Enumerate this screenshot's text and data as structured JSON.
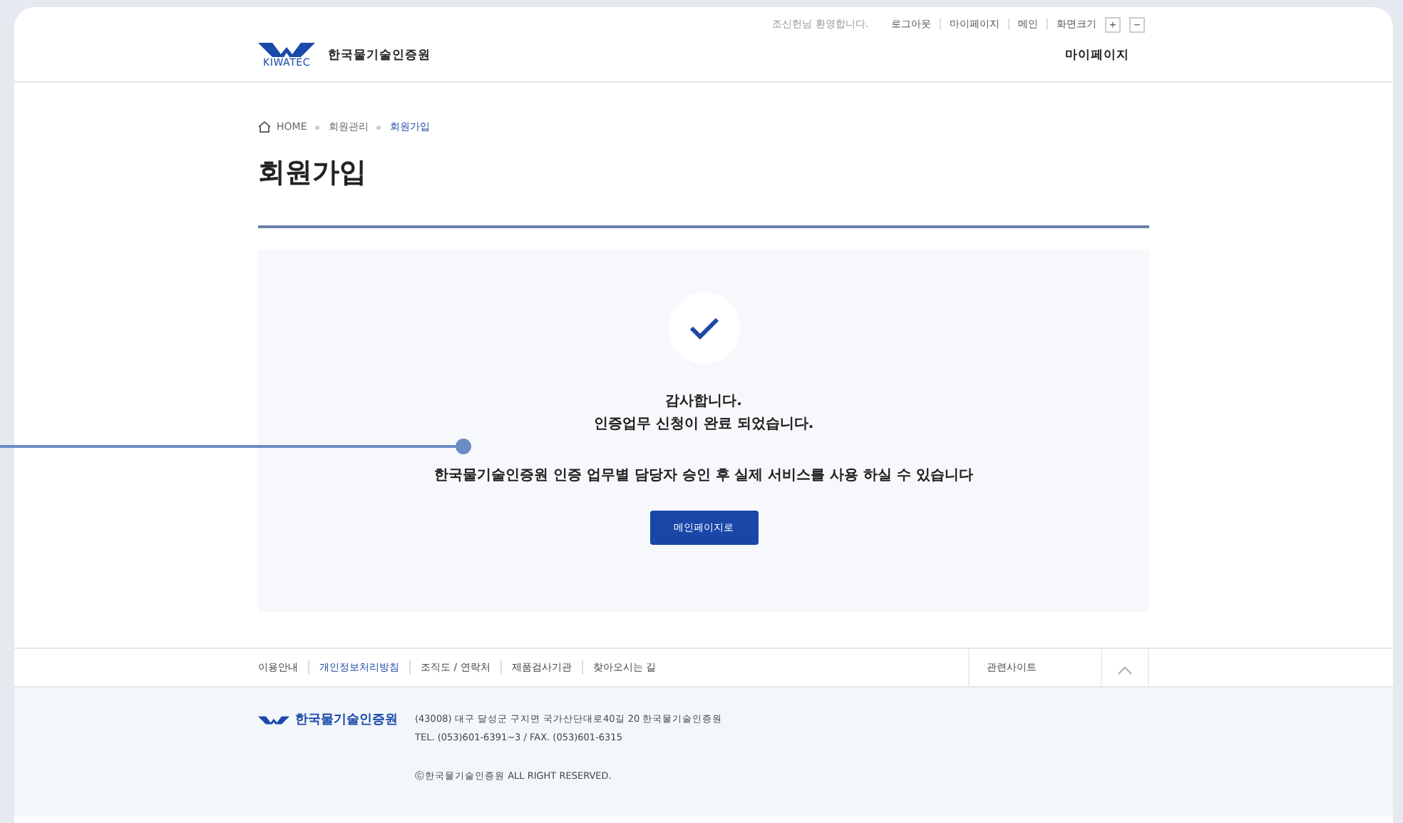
{
  "top_bar": {
    "greeting": "조신헌님 환영합니다.",
    "links": [
      "로그아웃",
      "마이페이지",
      "메인"
    ],
    "zoom_label": "화면크기",
    "zoom_in": "+",
    "zoom_out": "−"
  },
  "header": {
    "logo_text": "KIWATEC",
    "site_name": "한국물기술인증원",
    "nav": "마이페이지"
  },
  "breadcrumb": [
    "HOME",
    "회원관리",
    "회원가입"
  ],
  "page_title": "회원가입",
  "message": {
    "lines": [
      "감사합니다.",
      "인증업무 신청이 완료 되었습니다."
    ],
    "note": "한국물기술인증원 인증 업무별 담당자 승인 후 실제 서비스를 사용 하실 수 있습니다",
    "button": "메인페이지로"
  },
  "footer": {
    "links": [
      {
        "label": "이용안내",
        "emphasis": false
      },
      {
        "label": "개인정보처리방침",
        "emphasis": true
      },
      {
        "label": "조직도 / 연락처",
        "emphasis": false
      },
      {
        "label": "제품검사기관",
        "emphasis": false
      },
      {
        "label": "찾아오시는 길",
        "emphasis": false
      }
    ],
    "related_sites": "관련사이트",
    "org_name": "한국물기술인증원",
    "address": "(43008) 대구 달성군 구지면 국가산단대로40길 20 한국물기술인증원",
    "phone": "TEL. (053)601-6391~3 / FAX. (053)601-6315",
    "copyright": "ⓒ한국물기술인증원 ALL RIGHT RESERVED."
  }
}
